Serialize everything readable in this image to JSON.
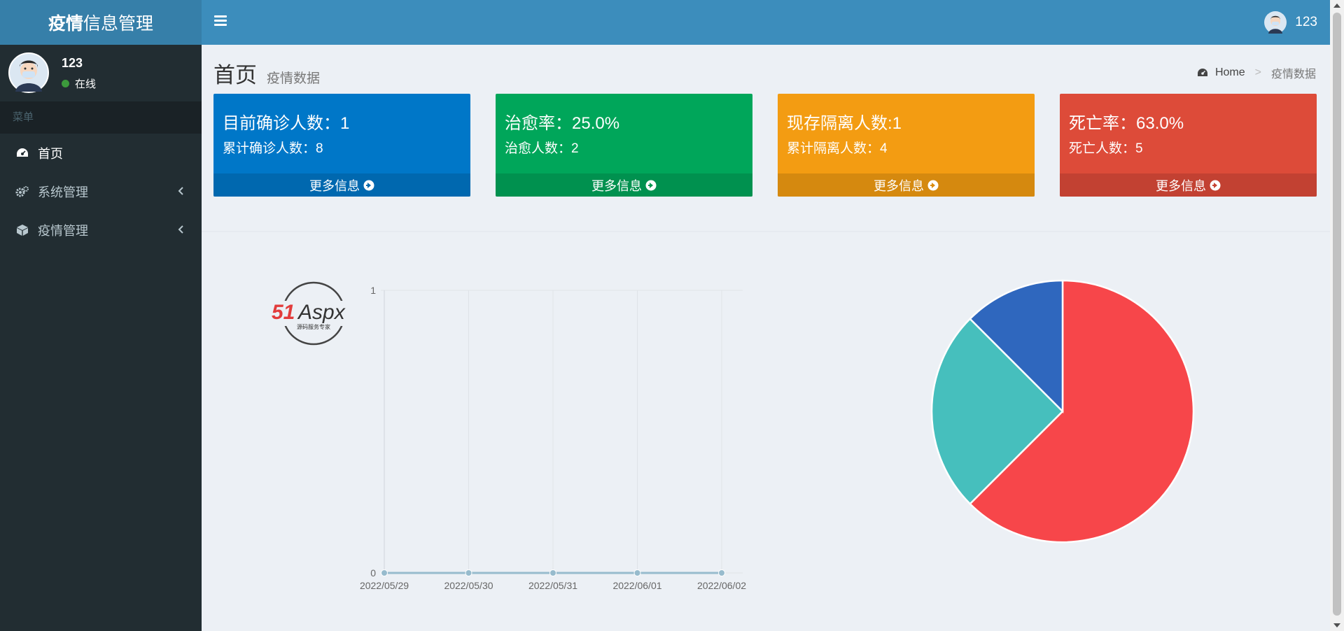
{
  "logo": {
    "bold": "疫情",
    "rest": "信息管理"
  },
  "navbar": {
    "user_name": "123"
  },
  "sidebar": {
    "user_name": "123",
    "status": "在线",
    "menu_header": "菜单",
    "items": [
      {
        "label": "首页",
        "icon": "dashboard-icon"
      },
      {
        "label": "系统管理",
        "icon": "gears-icon"
      },
      {
        "label": "疫情管理",
        "icon": "cube-icon"
      }
    ]
  },
  "header": {
    "title": "首页",
    "subtitle": "疫情数据"
  },
  "breadcrumb": {
    "home": "Home",
    "sep": ">",
    "current": "疫情数据"
  },
  "boxes": [
    {
      "big": "目前确诊人数：1",
      "small": "累计确诊人数：8",
      "footer": "更多信息",
      "color": "#0073b7"
    },
    {
      "big": "治愈率：25.0%",
      "small": "治愈人数：2",
      "footer": "更多信息",
      "color": "#00a65a"
    },
    {
      "big": "现存隔离人数:1",
      "small": "累计隔离人数：4",
      "footer": "更多信息",
      "color": "#f39c12"
    },
    {
      "big": "死亡率：63.0%",
      "small": "死亡人数：5",
      "footer": "更多信息",
      "color": "#dd4b39"
    }
  ],
  "watermark": {
    "logo_text_red": "51",
    "logo_text_dark": "Aspx",
    "tagline": "源码服务专家"
  },
  "chart_data": [
    {
      "type": "line",
      "x": [
        "2022/05/29",
        "2022/05/30",
        "2022/05/31",
        "2022/06/01",
        "2022/06/02"
      ],
      "series": [
        {
          "values": [
            0,
            0,
            0,
            0,
            0
          ],
          "color": "#97bbcd"
        }
      ],
      "ylim": [
        0,
        1
      ],
      "yticks": [
        "0",
        "1"
      ],
      "grid": true
    },
    {
      "type": "pie",
      "slices": [
        {
          "value": 5,
          "color": "#f7464a"
        },
        {
          "value": 2,
          "color": "#46bfbd"
        },
        {
          "value": 1,
          "color": "#2f67be"
        }
      ]
    }
  ]
}
